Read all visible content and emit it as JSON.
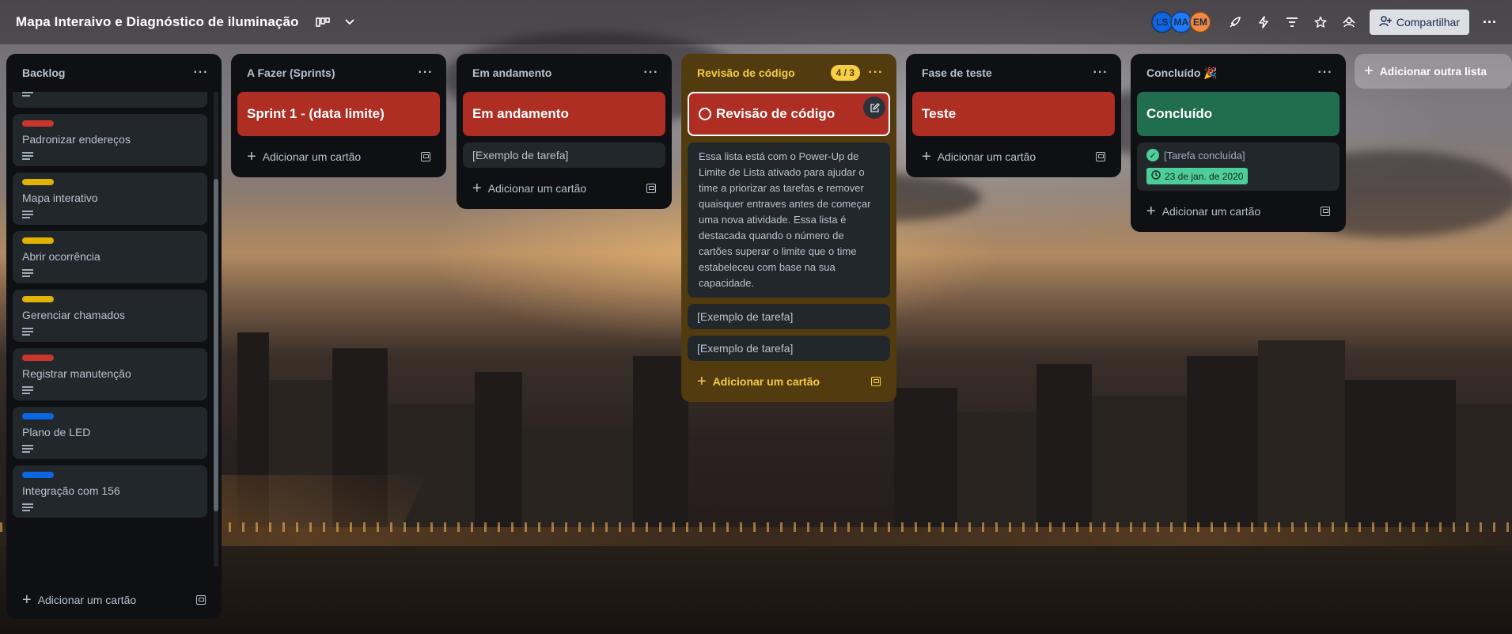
{
  "header": {
    "board_title": "Mapa Interaivo e Diagnóstico de iluminação",
    "avatars": [
      {
        "initials": "LS",
        "color": "#0c66e4"
      },
      {
        "initials": "MA",
        "color": "#1d7afc"
      },
      {
        "initials": "EM",
        "color": "#f38a3f"
      }
    ],
    "share_label": "Compartilhar"
  },
  "add_card_label": "Adicionar um cartão",
  "add_list_label": "Adicionar outra lista",
  "lists": {
    "backlog": {
      "title": "Backlog",
      "cards": [
        {
          "label": "Padronizar endereços",
          "color": "#c9372c"
        },
        {
          "label": "Mapa interativo",
          "color": "#e2b203"
        },
        {
          "label": "Abrir ocorrência",
          "color": "#e2b203"
        },
        {
          "label": "Gerenciar chamados",
          "color": "#e2b203"
        },
        {
          "label": "Registrar manutenção",
          "color": "#c9372c"
        },
        {
          "label": "Plano de LED",
          "color": "#0c66e4"
        },
        {
          "label": "Integração com 156",
          "color": "#0c66e4"
        }
      ]
    },
    "todo": {
      "title": "A Fazer (Sprints)",
      "cover": "Sprint 1 - (data limite)"
    },
    "doing": {
      "title": "Em andamento",
      "cover": "Em andamento",
      "card": "[Exemplo de tarefa]"
    },
    "review": {
      "title": "Revisão de código",
      "count": "4 / 3",
      "cover": "Revisão de código",
      "description": "Essa lista está com o Power-Up de Limite de Lista ativado para ajudar o time a priorizar as tarefas e remover quaisquer entraves antes de começar uma nova atividade. Essa lista é destacada quando o número de cartões superar o limite que o time estabeleceu com base na sua capacidade.",
      "cards": [
        "[Exemplo de tarefa]",
        "[Exemplo de tarefa]"
      ]
    },
    "test": {
      "title": "Fase de teste",
      "cover": "Teste"
    },
    "done": {
      "title": "Concluído 🎉",
      "cover": "Concluído",
      "card": "[Tarefa concluída]",
      "due": "23 de jan. de 2020"
    }
  },
  "colors": {
    "cover_red": "#ae2e24",
    "cover_green": "#216e4e",
    "review_list": "#533b10",
    "review_accent": "#f5cd47"
  }
}
